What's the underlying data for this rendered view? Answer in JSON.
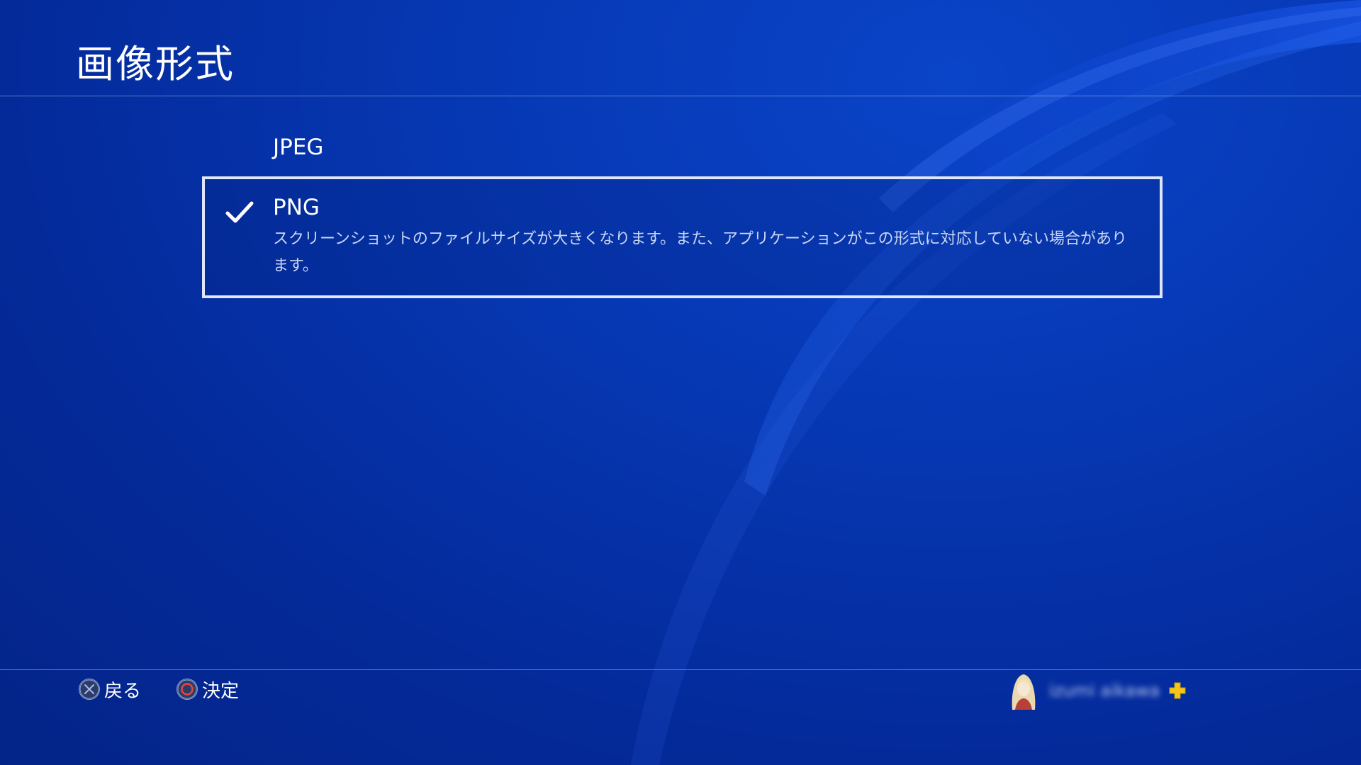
{
  "header": {
    "title": "画像形式"
  },
  "options": [
    {
      "label": "JPEG",
      "selected": false
    },
    {
      "label": "PNG",
      "selected": true,
      "description": "スクリーンショットのファイルサイズが大きくなります。また、アプリケーションがこの形式に対応していない場合があります。"
    }
  ],
  "footer": {
    "back_label": "戻る",
    "confirm_label": "決定",
    "back_icon": "cross-button-icon",
    "confirm_icon": "circle-button-icon",
    "username": "izumi aikawa",
    "plus_icon": "playstation-plus-icon"
  },
  "colors": {
    "background": "#0638b4",
    "accent_plus": "#f5c518",
    "circle_button": "#e8473a"
  }
}
